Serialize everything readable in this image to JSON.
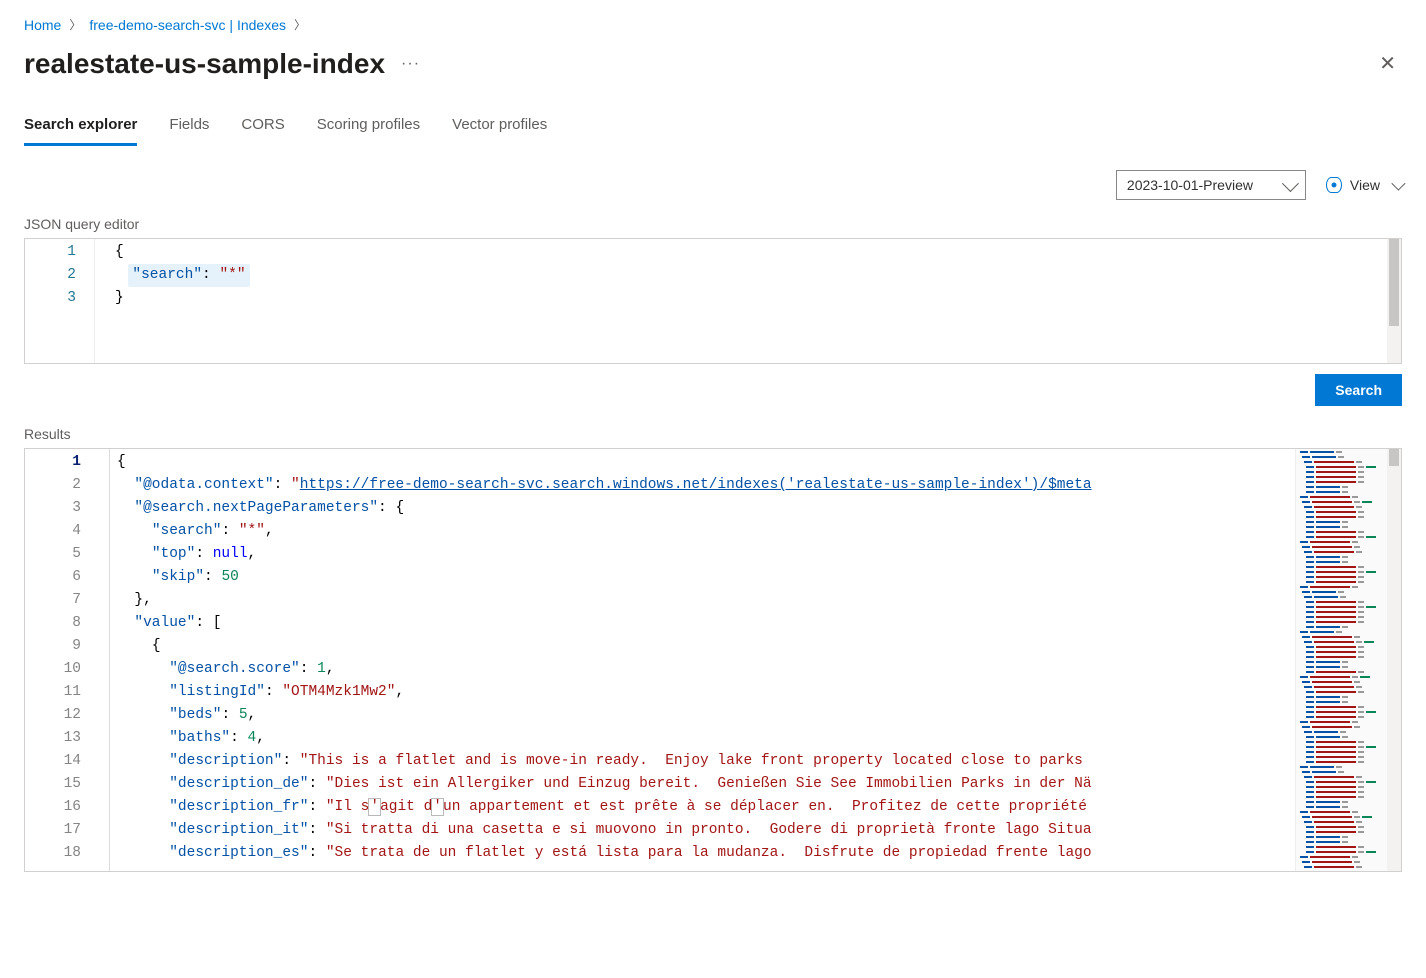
{
  "breadcrumb": {
    "home": "Home",
    "service": "free-demo-search-svc | Indexes"
  },
  "title": "realestate-us-sample-index",
  "tabs": [
    "Search explorer",
    "Fields",
    "CORS",
    "Scoring profiles",
    "Vector profiles"
  ],
  "active_tab": 0,
  "api_version": "2023-10-01-Preview",
  "view_label": "View",
  "query_label": "JSON query editor",
  "search_button": "Search",
  "results_label": "Results",
  "query": {
    "lines": [
      {
        "n": "1",
        "tokens": [
          {
            "t": "{",
            "c": "pun"
          }
        ]
      },
      {
        "n": "2",
        "highlight": true,
        "indent": 1,
        "tokens": [
          {
            "t": "\"search\"",
            "c": "key"
          },
          {
            "t": ": ",
            "c": "pun"
          },
          {
            "t": "\"*\"",
            "c": "str"
          }
        ]
      },
      {
        "n": "3",
        "tokens": [
          {
            "t": "}",
            "c": "pun"
          }
        ]
      }
    ]
  },
  "results": {
    "lines": [
      {
        "n": "1",
        "indent": 0,
        "tokens": [
          {
            "t": "{",
            "c": "pun"
          }
        ]
      },
      {
        "n": "2",
        "indent": 1,
        "tokens": [
          {
            "t": "\"@odata.context\"",
            "c": "key"
          },
          {
            "t": ": ",
            "c": "pun"
          },
          {
            "t": "\"",
            "c": "str"
          },
          {
            "t": "https://free-demo-search-svc.search.windows.net/indexes('realestate-us-sample-index')/$meta",
            "c": "lnk"
          }
        ]
      },
      {
        "n": "3",
        "indent": 1,
        "tokens": [
          {
            "t": "\"@search.nextPageParameters\"",
            "c": "key"
          },
          {
            "t": ": {",
            "c": "pun"
          }
        ]
      },
      {
        "n": "4",
        "indent": 2,
        "tokens": [
          {
            "t": "\"search\"",
            "c": "key"
          },
          {
            "t": ": ",
            "c": "pun"
          },
          {
            "t": "\"*\"",
            "c": "str"
          },
          {
            "t": ",",
            "c": "pun"
          }
        ]
      },
      {
        "n": "5",
        "indent": 2,
        "tokens": [
          {
            "t": "\"top\"",
            "c": "key"
          },
          {
            "t": ": ",
            "c": "pun"
          },
          {
            "t": "null",
            "c": "nul"
          },
          {
            "t": ",",
            "c": "pun"
          }
        ]
      },
      {
        "n": "6",
        "indent": 2,
        "tokens": [
          {
            "t": "\"skip\"",
            "c": "key"
          },
          {
            "t": ": ",
            "c": "pun"
          },
          {
            "t": "50",
            "c": "num"
          }
        ]
      },
      {
        "n": "7",
        "indent": 1,
        "tokens": [
          {
            "t": "},",
            "c": "pun"
          }
        ]
      },
      {
        "n": "8",
        "indent": 1,
        "tokens": [
          {
            "t": "\"value\"",
            "c": "key"
          },
          {
            "t": ": [",
            "c": "pun"
          }
        ]
      },
      {
        "n": "9",
        "indent": 2,
        "tokens": [
          {
            "t": "{",
            "c": "pun"
          }
        ]
      },
      {
        "n": "10",
        "indent": 3,
        "tokens": [
          {
            "t": "\"@search.score\"",
            "c": "key"
          },
          {
            "t": ": ",
            "c": "pun"
          },
          {
            "t": "1",
            "c": "num"
          },
          {
            "t": ",",
            "c": "pun"
          }
        ]
      },
      {
        "n": "11",
        "indent": 3,
        "tokens": [
          {
            "t": "\"listingId\"",
            "c": "key"
          },
          {
            "t": ": ",
            "c": "pun"
          },
          {
            "t": "\"OTM4Mzk1Mw2\"",
            "c": "str"
          },
          {
            "t": ",",
            "c": "pun"
          }
        ]
      },
      {
        "n": "12",
        "indent": 3,
        "tokens": [
          {
            "t": "\"beds\"",
            "c": "key"
          },
          {
            "t": ": ",
            "c": "pun"
          },
          {
            "t": "5",
            "c": "num"
          },
          {
            "t": ",",
            "c": "pun"
          }
        ]
      },
      {
        "n": "13",
        "indent": 3,
        "tokens": [
          {
            "t": "\"baths\"",
            "c": "key"
          },
          {
            "t": ": ",
            "c": "pun"
          },
          {
            "t": "4",
            "c": "num"
          },
          {
            "t": ",",
            "c": "pun"
          }
        ]
      },
      {
        "n": "14",
        "indent": 3,
        "tokens": [
          {
            "t": "\"description\"",
            "c": "key"
          },
          {
            "t": ": ",
            "c": "pun"
          },
          {
            "t": "\"This is a flatlet and is move-in ready.  Enjoy lake front property located close to parks",
            "c": "str"
          }
        ]
      },
      {
        "n": "15",
        "indent": 3,
        "tokens": [
          {
            "t": "\"description_de\"",
            "c": "key"
          },
          {
            "t": ": ",
            "c": "pun"
          },
          {
            "t": "\"Dies ist ein Allergiker und Einzug bereit.  Genießen Sie See Immobilien Parks in der Nä",
            "c": "str"
          }
        ]
      },
      {
        "n": "16",
        "indent": 3,
        "tokens": [
          {
            "t": "\"description_fr\"",
            "c": "key"
          },
          {
            "t": ": ",
            "c": "pun"
          },
          {
            "t": "\"Il s",
            "c": "str"
          },
          {
            "t": "'",
            "c": "str",
            "br": true
          },
          {
            "t": "agit d",
            "c": "str"
          },
          {
            "t": "'",
            "c": "str",
            "br": true
          },
          {
            "t": "un appartement et est prête à se déplacer en.  Profitez de cette propriété",
            "c": "str"
          }
        ]
      },
      {
        "n": "17",
        "indent": 3,
        "tokens": [
          {
            "t": "\"description_it\"",
            "c": "key"
          },
          {
            "t": ": ",
            "c": "pun"
          },
          {
            "t": "\"Si tratta di una casetta e si muovono in pronto.  Godere di proprietà fronte lago Situa",
            "c": "str"
          }
        ]
      },
      {
        "n": "18",
        "indent": 3,
        "tokens": [
          {
            "t": "\"description_es\"",
            "c": "key"
          },
          {
            "t": ": ",
            "c": "pun"
          },
          {
            "t": "\"Se trata de un flatlet y está lista para la mudanza.  Disfrute de propiedad frente lago",
            "c": "str"
          }
        ]
      }
    ]
  }
}
